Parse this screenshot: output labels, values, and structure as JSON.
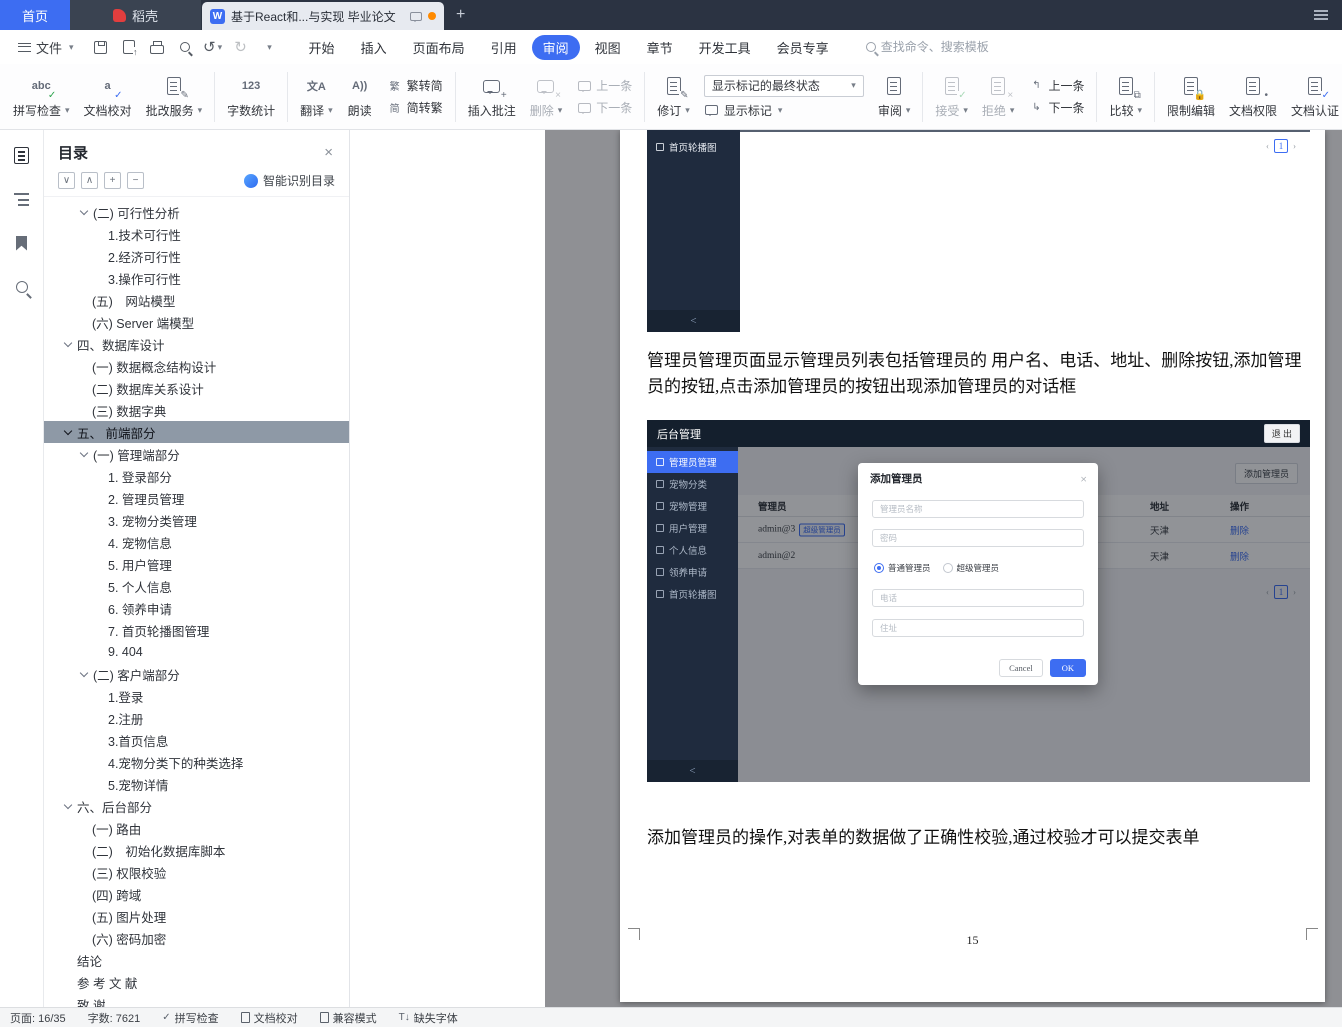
{
  "tabbar": {
    "home_label": "首页",
    "docer_label": "稻壳",
    "doc_title": "基于React和...与实现 毕业论文",
    "new_tab": "+"
  },
  "menubar": {
    "file_label": "文件",
    "tabs": [
      "开始",
      "插入",
      "页面布局",
      "引用",
      "审阅",
      "视图",
      "章节",
      "开发工具",
      "会员专享"
    ],
    "search_placeholder": "查找命令、搜索模板"
  },
  "ribbon": {
    "spell_check": "拼写检查",
    "doc_proof": "文档校对",
    "grading_service": "批改服务",
    "word_count": "字数统计",
    "translate": "翻译",
    "read_aloud": "朗读",
    "trad_to_simp": "繁转简",
    "simp_to_trad": "简转繁",
    "insert_comment": "插入批注",
    "delete_comment": "删除",
    "prev_comment": "上一条",
    "next_comment": "下一条",
    "track_changes": "修订",
    "markup_state": "显示标记的最终状态",
    "show_markup": "显示标记",
    "review": "审阅",
    "accept": "接受",
    "reject": "拒绝",
    "prev_change": "上一条",
    "next_change": "下一条",
    "compare": "比较",
    "restrict_edit": "限制编辑",
    "doc_permission": "文档权限",
    "doc_cert": "文档认证",
    "doc_more": "文档"
  },
  "toc": {
    "title": "目录",
    "smart_recognize": "智能识别目录",
    "items": [
      "(二) 可行性分析",
      "1.技术可行性",
      "2.经济可行性",
      "3.操作可行性",
      "(五)　网站模型",
      "(六) Server 端模型",
      "四、数据库设计",
      "(一) 数据概念结构设计",
      "(二) 数据库关系设计",
      "(三) 数据字典",
      "五、 前端部分",
      "(一) 管理端部分",
      "1. 登录部分",
      "2. 管理员管理",
      "3. 宠物分类管理",
      "4. 宠物信息",
      "5. 用户管理",
      "5. 个人信息",
      "6. 领养申请",
      "7. 首页轮播图管理",
      "9. 404",
      "(二) 客户端部分",
      "1.登录",
      "2.注册",
      "3.首页信息",
      "4.宠物分类下的种类选择",
      "5.宠物详情",
      "六、后台部分",
      "(一) 路由",
      "(二)　初始化数据库脚本",
      "(三) 权限校验",
      "(四) 跨域",
      "(五) 图片处理",
      "(六) 密码加密",
      "结论",
      "参 考 文 献",
      "致 谢"
    ]
  },
  "document": {
    "para1": "管理员管理页面显示管理员列表包括管理员的 用户名、电话、地址、删除按钮,添加管理员的按钮,点击添加管理员的按钮出现添加管理员的对话框",
    "para2": "添加管理员的操作,对表单的数据做了正确性校验,通过校验才可以提交表单",
    "page_number": "15",
    "shot1": {
      "sidebar_item": "首页轮播图",
      "collapse": "<",
      "pagination_current": "1"
    },
    "shot2": {
      "header_title": "后台管理",
      "logout": "退 出",
      "menu": [
        "管理员管理",
        "宠物分类",
        "宠物管理",
        "用户管理",
        "个人信息",
        "领养申请",
        "首页轮播图"
      ],
      "collapse": "<",
      "add_button": "添加管理员",
      "table": {
        "col_admin": "管理员",
        "col_address": "地址",
        "col_action": "操作",
        "rows": [
          {
            "name": "admin@3",
            "tag": "超级管理员",
            "address": "天津",
            "action": "删除"
          },
          {
            "name": "admin@2",
            "tag": "",
            "address": "天津",
            "action": "删除"
          }
        ]
      },
      "pagination_current": "1",
      "modal": {
        "title": "添加管理员",
        "close": "×",
        "name_placeholder": "管理员名称",
        "password_placeholder": "密码",
        "radio_normal": "普通管理员",
        "radio_super": "超级管理员",
        "phone_placeholder": "电话",
        "address_placeholder": "住址",
        "cancel": "Cancel",
        "ok": "OK"
      }
    }
  },
  "statusbar": {
    "page": "页面: 16/35",
    "words": "字数: 7621",
    "spell": "拼写检查",
    "proof": "文档校对",
    "compat": "兼容模式",
    "missing_font": "缺失字体"
  },
  "colors": {
    "accent_blue": "#3d6df2",
    "dark_sidebar": "#1f2b3e",
    "canvas_gray": "#8f9094"
  }
}
